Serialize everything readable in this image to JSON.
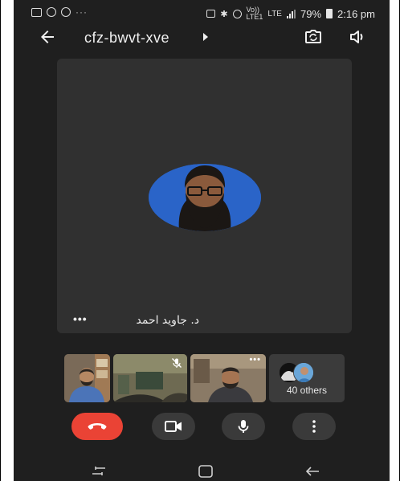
{
  "status_bar": {
    "overflow_dots": "···",
    "network_top": "Vo))",
    "network_bottom": "LTE1",
    "lte_label": "LTE",
    "battery_percent": "79%",
    "time": "2:16 pm"
  },
  "top_bar": {
    "meeting_code": "cfz-bwvt-xve"
  },
  "main_tile": {
    "participant_name": "د. جاوید احمد",
    "more_dots": "•••"
  },
  "thumbnails": [
    {
      "muted": false,
      "has_menu": false
    },
    {
      "muted": true,
      "has_menu": false
    },
    {
      "muted": false,
      "has_menu": true,
      "menu_dots": "•••"
    },
    {
      "others_label": "40 others"
    }
  ],
  "colors": {
    "background": "#1f1f1f",
    "tile": "#303030",
    "end_call": "#ea4335",
    "control_button": "#3a3a3a",
    "avatar_bg": "#2a64c8"
  },
  "icons": {
    "back": "arrow-left-icon",
    "switch_camera": "switch-camera-icon",
    "speaker": "speaker-icon",
    "end_call": "phone-hangup-icon",
    "camera": "video-camera-icon",
    "microphone": "microphone-icon",
    "more": "more-vertical-icon"
  }
}
